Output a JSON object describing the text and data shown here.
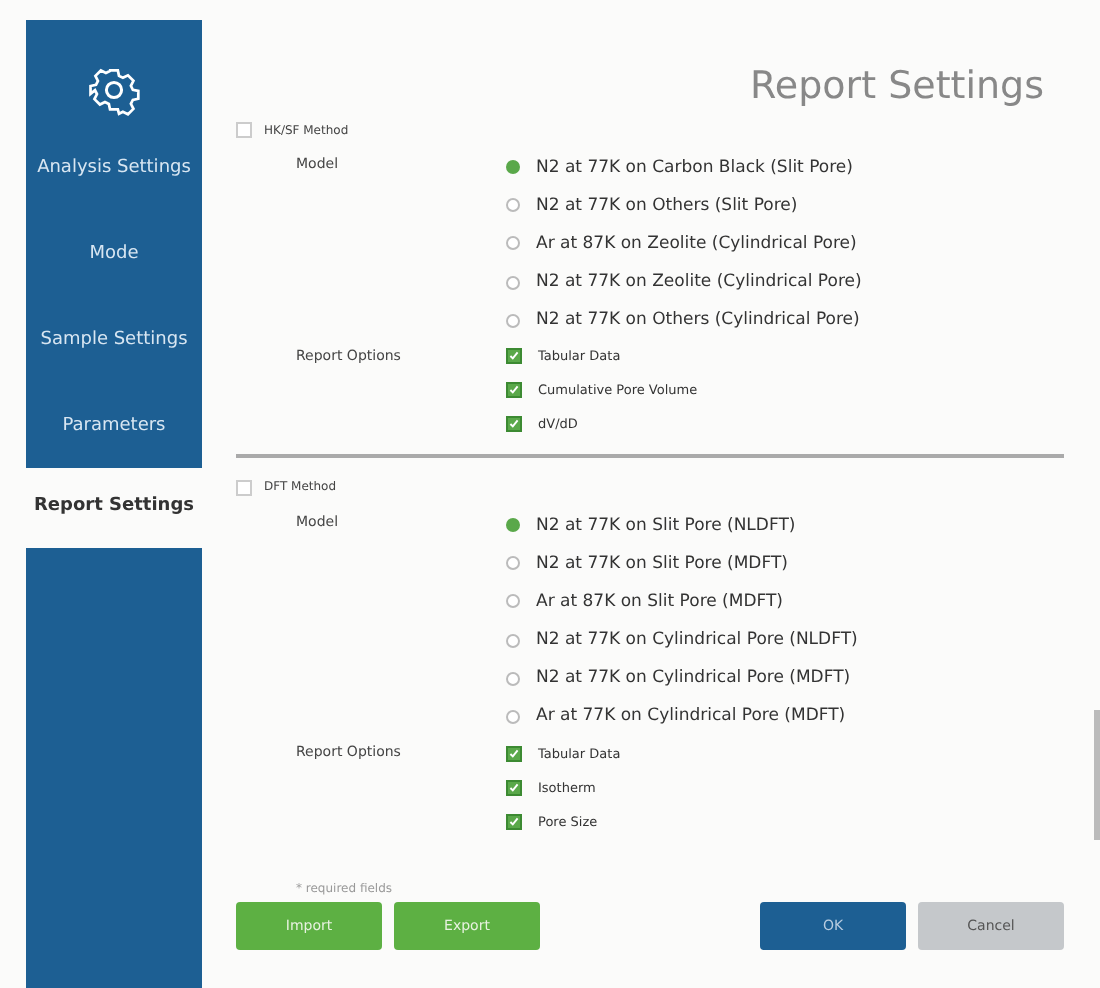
{
  "sidebar": {
    "items": [
      {
        "label": "Analysis Settings",
        "selected": false
      },
      {
        "label": "Mode",
        "selected": false
      },
      {
        "label": "Sample Settings",
        "selected": false
      },
      {
        "label": "Parameters",
        "selected": false
      },
      {
        "label": "Report Settings",
        "selected": true
      }
    ]
  },
  "title": "Report Settings",
  "sections": [
    {
      "label": "HK/SF Method",
      "checked": false,
      "model_label": "Model",
      "options_label": "Report Options",
      "models": [
        {
          "label": "N2 at 77K on Carbon Black (Slit Pore)",
          "selected": true
        },
        {
          "label": "N2 at 77K on Others (Slit Pore)",
          "selected": false
        },
        {
          "label": "Ar at 87K on Zeolite (Cylindrical Pore)",
          "selected": false
        },
        {
          "label": "N2 at 77K on Zeolite (Cylindrical Pore)",
          "selected": false
        },
        {
          "label": "N2 at 77K on Others (Cylindrical Pore)",
          "selected": false
        }
      ],
      "options": [
        {
          "label": "Tabular Data",
          "checked": true
        },
        {
          "label": "Cumulative Pore Volume",
          "checked": true
        },
        {
          "label": "dV/dD",
          "checked": true
        }
      ]
    },
    {
      "label": "DFT Method",
      "checked": false,
      "model_label": "Model",
      "options_label": "Report Options",
      "models": [
        {
          "label": "N2 at 77K on Slit Pore (NLDFT)",
          "selected": true
        },
        {
          "label": "N2 at 77K on Slit Pore (MDFT)",
          "selected": false
        },
        {
          "label": "Ar at 87K on Slit Pore (MDFT)",
          "selected": false
        },
        {
          "label": "N2 at 77K on Cylindrical Pore (NLDFT)",
          "selected": false
        },
        {
          "label": "N2 at 77K on Cylindrical Pore (MDFT)",
          "selected": false
        },
        {
          "label": "Ar at 77K on Cylindrical Pore (MDFT)",
          "selected": false
        }
      ],
      "options": [
        {
          "label": "Tabular Data",
          "checked": true
        },
        {
          "label": "Isotherm",
          "checked": true
        },
        {
          "label": "Pore Size",
          "checked": true
        }
      ]
    }
  ],
  "footnote": "* required fields",
  "buttons": [
    {
      "label": "Import",
      "kind": "green"
    },
    {
      "label": "Export",
      "kind": "green"
    },
    {
      "label": "OK",
      "kind": "primary"
    },
    {
      "label": "Cancel",
      "kind": "disabled"
    }
  ]
}
